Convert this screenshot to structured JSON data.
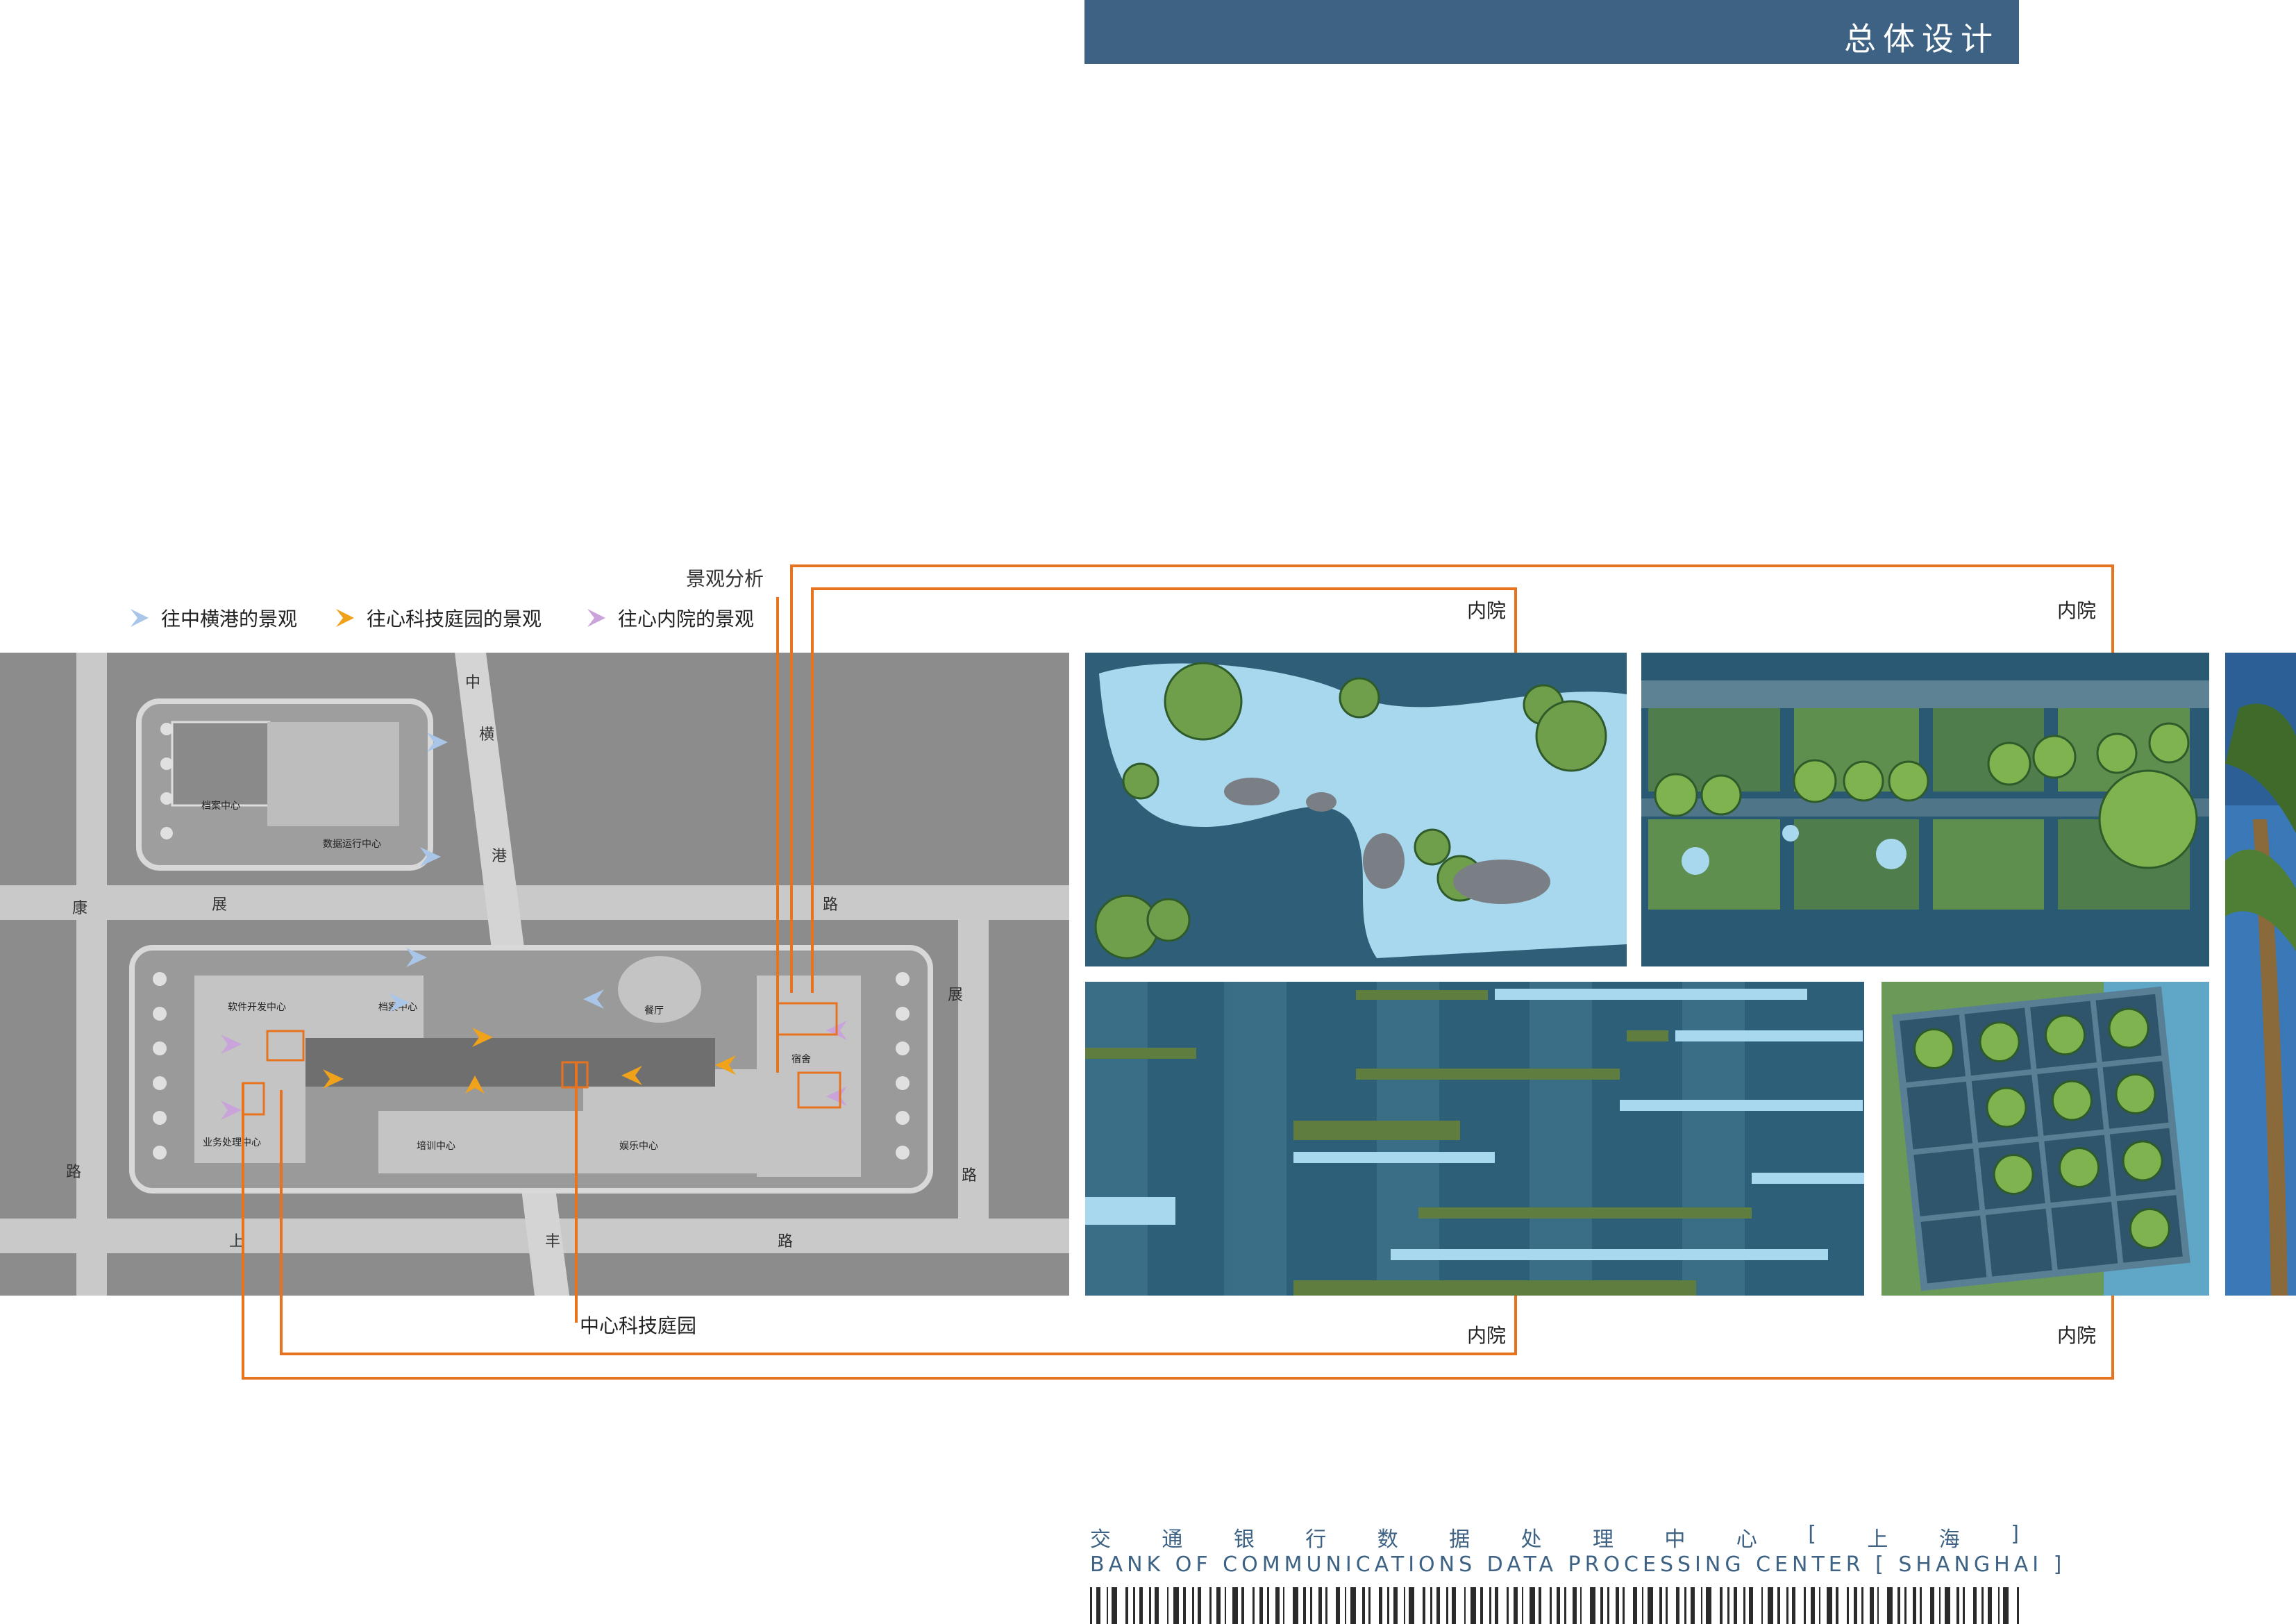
{
  "header": {
    "title": "总体设计"
  },
  "analysis": {
    "title": "景观分析",
    "legend": [
      {
        "label": "往中横港的景观",
        "color": "#a9c6e8"
      },
      {
        "label": "往心科技庭园的景观",
        "color": "#f0a21a"
      },
      {
        "label": "往心内院的景观",
        "color": "#c9a3d9"
      }
    ]
  },
  "siteplan": {
    "roads": {
      "zhong": "中",
      "heng": "横",
      "gang": "港",
      "kang": "康",
      "zhan": "展",
      "lu": "路",
      "shang": "上",
      "feng": "丰"
    },
    "buildings": {
      "b1": "档案中心",
      "b2": "数据运行中心",
      "b3": "软件开发中心",
      "b4": "档案中心",
      "b5": "餐厅",
      "b6": "宿舍",
      "b7": "培训中心",
      "b8": "娱乐中心",
      "b9": "业务处理中心"
    },
    "callout": "中心科技庭园"
  },
  "courtyard_labels": {
    "c1": "内院",
    "c2": "内院",
    "c3": "内院",
    "c4": "内院"
  },
  "footer": {
    "cn_chars": [
      "交",
      "通",
      "银",
      "行",
      "数",
      "据",
      "处",
      "理",
      "中",
      "心",
      "[",
      "上",
      "海",
      "]"
    ],
    "en": "BANK OF COMMUNICATIONS DATA PROCESSING CENTER [ SHANGHAI ]"
  },
  "colors": {
    "header": "#3e6283",
    "orange_line": "#e8731f",
    "water": "#a7d8ee",
    "deep": "#2f5f78",
    "green": "#6c9a4c"
  }
}
